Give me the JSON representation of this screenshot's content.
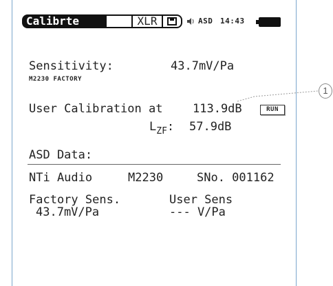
{
  "statusbar": {
    "mode": "Calibrte",
    "input": "XLR",
    "asd": "ASD",
    "time": "14:43"
  },
  "calibration": {
    "sensitivity_label": "Sensitivity:",
    "sensitivity_value": "43.7mV/Pa",
    "mic_source": "M2230 FACTORY",
    "user_cal_label": "User Calibration at",
    "user_cal_level": "113.9dB",
    "run_label": "RUN",
    "lzf_label_main": "L",
    "lzf_label_sub": "ZF",
    "lzf_colon": ":",
    "lzf_value": "57.9dB"
  },
  "asd_data": {
    "heading": "ASD Data:",
    "manufacturer": "NTi Audio",
    "model": "M2230",
    "serial": "SNo. 001162",
    "factory_label": "Factory Sens.",
    "factory_value": "43.7mV/Pa",
    "user_label": "User Sens",
    "user_value": "--- V/Pa"
  },
  "callout": {
    "number": "1"
  }
}
